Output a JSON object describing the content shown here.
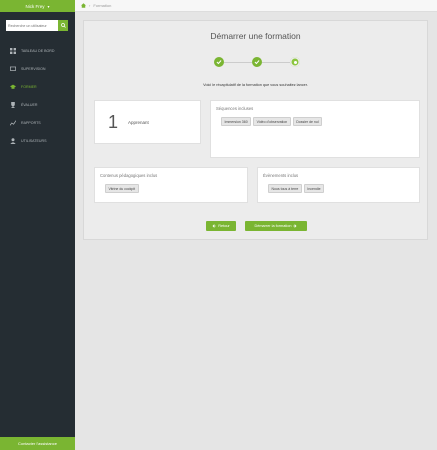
{
  "sidebar": {
    "user_name": "Nick Frey",
    "search_placeholder": "Recherche un utilisateur",
    "items": [
      {
        "label": "Tableau de bord",
        "icon": "grid-icon"
      },
      {
        "label": "Supervision",
        "icon": "monitor-icon"
      },
      {
        "label": "Former",
        "icon": "graduation-cap-icon",
        "active": true
      },
      {
        "label": "Évaluer",
        "icon": "trophy-icon"
      },
      {
        "label": "Rapports",
        "icon": "chart-line-icon"
      },
      {
        "label": "Utilisateurs",
        "icon": "user-icon"
      }
    ],
    "footer": "Contacter l'assistance"
  },
  "breadcrumb": {
    "current": "Formation"
  },
  "main": {
    "title": "Démarrer une formation",
    "steps_completed": 2,
    "steps_total": 3,
    "recap_text": "Voici le récapitulatif de la formation que vous souhaitez lancer.",
    "learners": {
      "count": "1",
      "label": "Apprenant"
    },
    "sequences": {
      "title": "Séquences incluses",
      "tags": [
        "Immersion 360",
        "Vidéo d'observation",
        "Dossier de nul"
      ]
    },
    "pedagogical": {
      "title": "Contenus pédagogiques inclus",
      "tags": [
        "Vitrine du cockpit"
      ]
    },
    "events": {
      "title": "Évènements inclus",
      "tags": [
        "Nous tous à terre",
        "Incendie"
      ]
    },
    "back_button": "Retour",
    "start_button": "Démarrer la formation"
  },
  "colors": {
    "accent": "#7ab532",
    "sidebar_bg": "#252d33"
  }
}
